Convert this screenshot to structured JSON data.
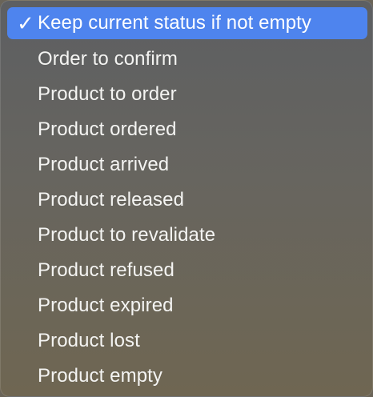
{
  "menu": {
    "selected_index": 0,
    "check_glyph": "✓",
    "accent_color": "#4e84ee",
    "items": [
      {
        "label": "Keep current status if not empty"
      },
      {
        "label": "Order to confirm"
      },
      {
        "label": "Product to order"
      },
      {
        "label": "Product ordered"
      },
      {
        "label": "Product arrived"
      },
      {
        "label": "Product released"
      },
      {
        "label": "Product to revalidate"
      },
      {
        "label": "Product refused"
      },
      {
        "label": "Product expired"
      },
      {
        "label": "Product lost"
      },
      {
        "label": "Product empty"
      }
    ]
  }
}
